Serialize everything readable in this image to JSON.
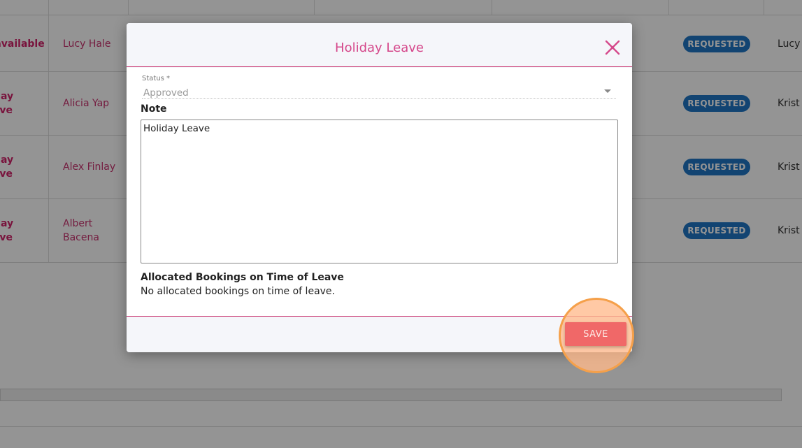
{
  "table": {
    "rows": [
      {
        "type": "Unavailable",
        "name": "Lucy Hale",
        "status": "REQUESTED",
        "approver": "Lucy"
      },
      {
        "type": "Holiday Leave",
        "name": "Alicia Yap",
        "status": "REQUESTED",
        "approver": "Krist"
      },
      {
        "type": "Holiday Leave",
        "name": "Alex Finlay",
        "status": "REQUESTED",
        "approver": "Krist"
      },
      {
        "type": "Holiday Leave",
        "name": "Albert Bacena",
        "status": "REQUESTED",
        "approver": "Krist"
      }
    ]
  },
  "modal": {
    "title": "Holiday Leave",
    "status_label": "Status *",
    "status_value": "Approved",
    "note_label": "Note",
    "note_value": "Holiday Leave",
    "allocated_title": "Allocated Bookings on Time of Leave",
    "allocated_text": "No allocated bookings on time of leave.",
    "save_label": "SAVE"
  },
  "colors": {
    "accent": "#d5478a",
    "status_pill": "#1f76c4",
    "save_button": "#f06868",
    "highlight": "#f5a04a"
  },
  "icons": {
    "close": "close-icon",
    "dropdown": "chevron-down-icon"
  }
}
